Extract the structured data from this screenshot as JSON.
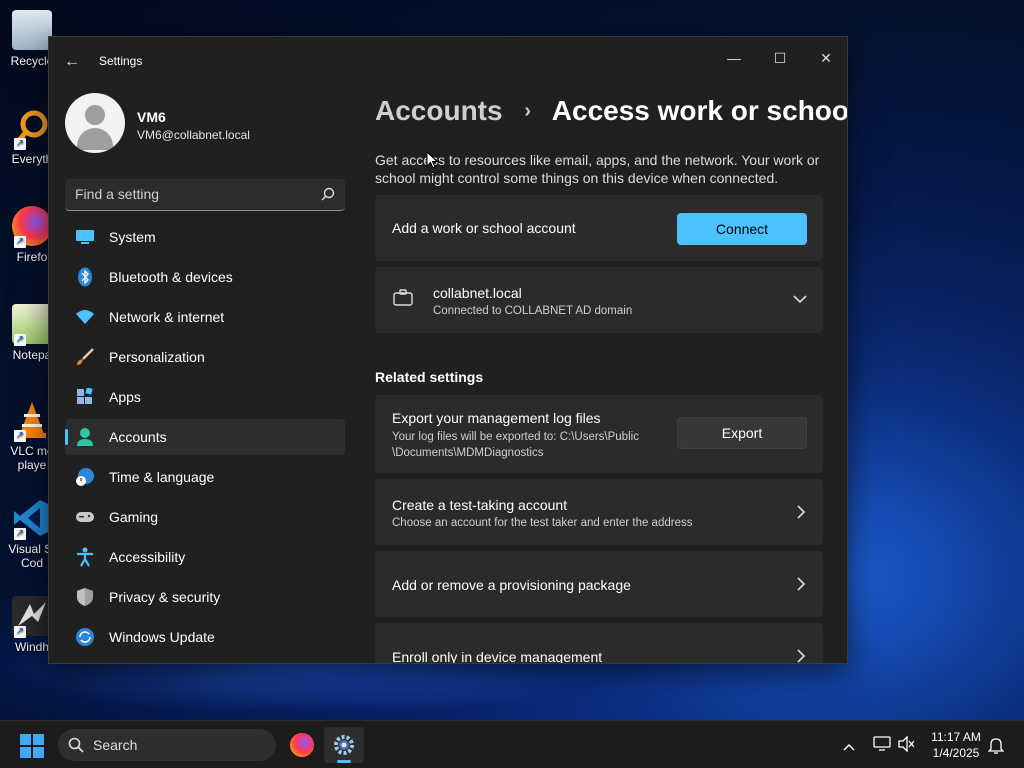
{
  "desktop": {
    "icons": [
      {
        "label": "Recycle",
        "icon": "recycle-bin-icon"
      },
      {
        "label": "Everyth",
        "icon": "everything-search-icon"
      },
      {
        "label": "Firefo",
        "icon": "firefox-icon"
      },
      {
        "label": "Notepa",
        "icon": "notepad-icon"
      },
      {
        "label": "VLC me",
        "label2": "playe",
        "icon": "vlc-icon"
      },
      {
        "label": "Visual St",
        "label2": "Cod",
        "icon": "vscode-icon"
      },
      {
        "label": "Windh",
        "icon": "windhawk-icon"
      }
    ]
  },
  "window": {
    "title": "Settings",
    "controls": {
      "minimize": "—",
      "maximize": "☐",
      "close": "✕"
    }
  },
  "profile": {
    "name": "VM6",
    "email": "VM6@collabnet.local"
  },
  "search": {
    "placeholder": "Find a setting"
  },
  "nav": {
    "items": [
      {
        "label": "System",
        "icon": "monitor-icon",
        "color": "#4cc2ff"
      },
      {
        "label": "Bluetooth & devices",
        "icon": "bluetooth-icon",
        "color": "#2b88d8"
      },
      {
        "label": "Network & internet",
        "icon": "wifi-icon",
        "color": "#4cc2ff"
      },
      {
        "label": "Personalization",
        "icon": "brush-icon",
        "color": "#e0a060"
      },
      {
        "label": "Apps",
        "icon": "apps-icon",
        "color": "#8fb8e8"
      },
      {
        "label": "Accounts",
        "icon": "person-icon",
        "color": "#2ec4a8",
        "active": true
      },
      {
        "label": "Time & language",
        "icon": "globe-clock-icon",
        "color": "#4cc2ff"
      },
      {
        "label": "Gaming",
        "icon": "gamepad-icon",
        "color": "#c8c8c8"
      },
      {
        "label": "Accessibility",
        "icon": "accessibility-icon",
        "color": "#4cc2ff"
      },
      {
        "label": "Privacy & security",
        "icon": "shield-icon",
        "color": "#a0a0a0"
      },
      {
        "label": "Windows Update",
        "icon": "update-icon",
        "color": "#2b88d8"
      }
    ]
  },
  "main": {
    "breadcrumb_parent": "Accounts",
    "breadcrumb_sep": "›",
    "breadcrumb_current": "Access work or school",
    "description": "Get access to resources like email, apps, and the network. Your work or school might control some things on this device when connected.",
    "add_account": {
      "label": "Add a work or school account",
      "button": "Connect"
    },
    "domain": {
      "name": "collabnet.local",
      "status": "Connected to COLLABNET AD domain"
    },
    "related_header": "Related settings",
    "export": {
      "title": "Export your management log files",
      "sub_line1": "Your log files will be exported to: C:\\Users\\Public",
      "sub_line2": "\\Documents\\MDMDiagnostics",
      "button": "Export"
    },
    "test_account": {
      "title": "Create a test-taking account",
      "sub": "Choose an account for the test taker and enter the address"
    },
    "provisioning": {
      "title": "Add or remove a provisioning package"
    },
    "enroll": {
      "title": "Enroll only in device management"
    }
  },
  "taskbar": {
    "search_label": "Search",
    "time": "11:17 AM",
    "date": "1/4/2025",
    "accent": "#4cc2ff"
  }
}
